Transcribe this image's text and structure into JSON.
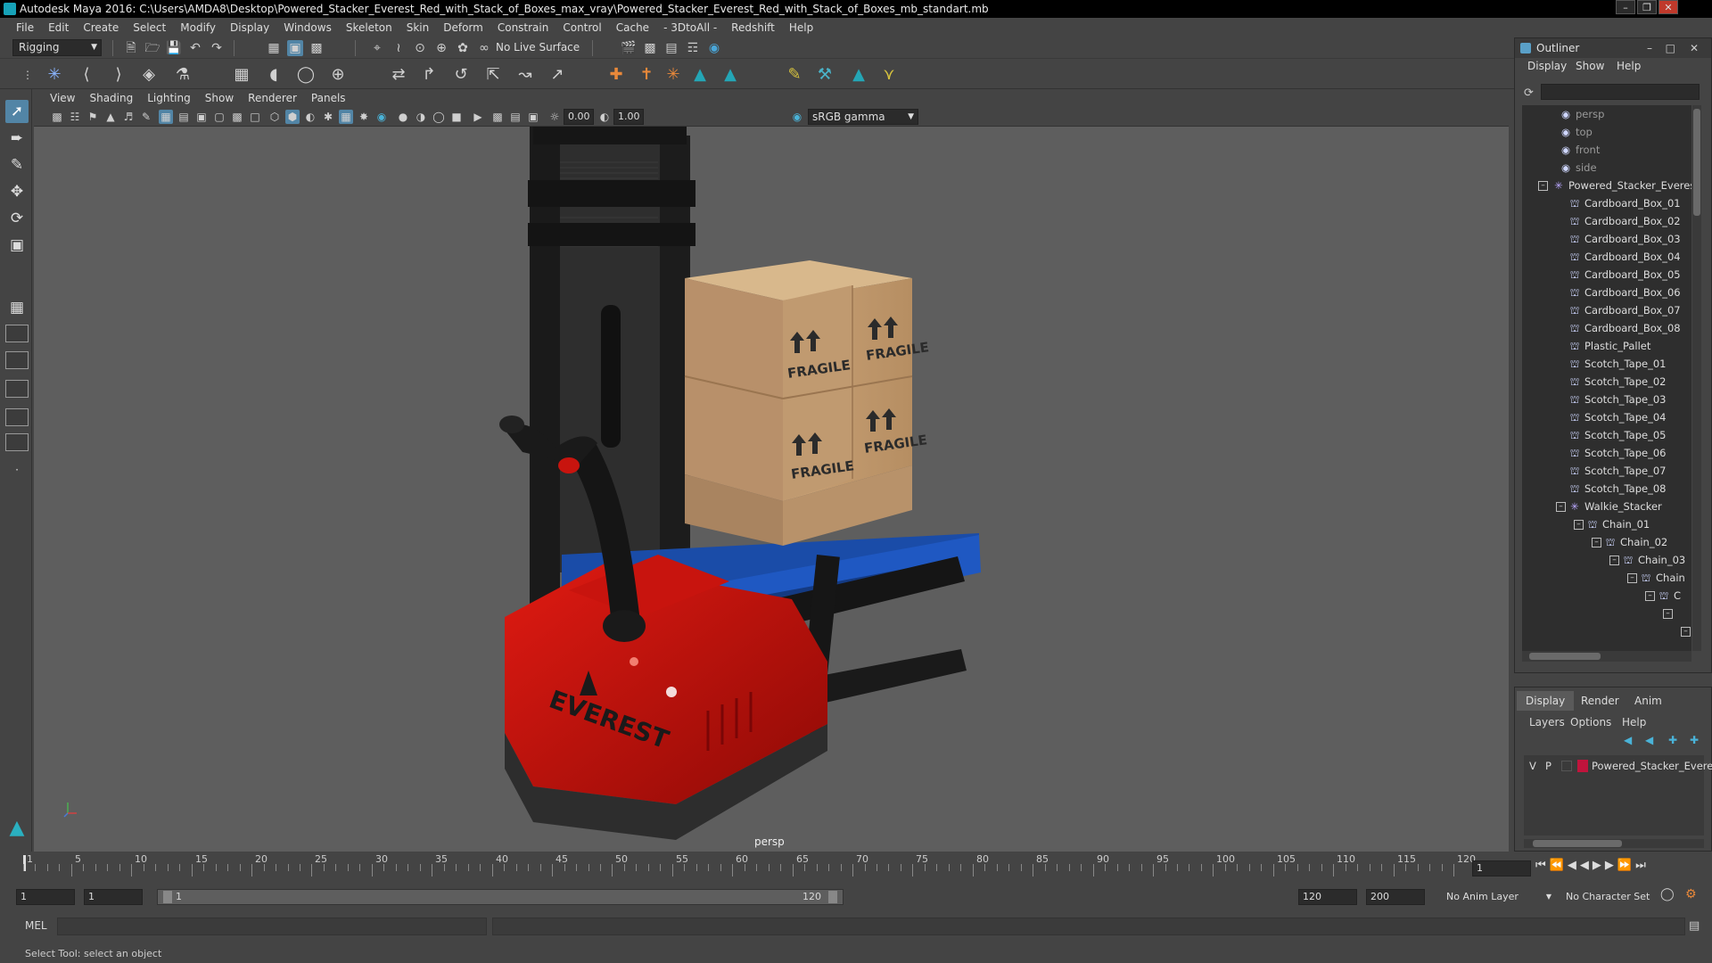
{
  "window": {
    "title": "Autodesk Maya 2016: C:\\Users\\AMDA8\\Desktop\\Powered_Stacker_Everest_Red_with_Stack_of_Boxes_max_vray\\Powered_Stacker_Everest_Red_with_Stack_of_Boxes_mb_standart.mb"
  },
  "menubar": [
    "File",
    "Edit",
    "Create",
    "Select",
    "Modify",
    "Display",
    "Windows",
    "Skeleton",
    "Skin",
    "Deform",
    "Constrain",
    "Control",
    "Cache",
    "- 3DtoAll -",
    "Redshift",
    "Help"
  ],
  "statusline": {
    "menuset": "Rigging",
    "live_surface": "No Live Surface"
  },
  "viewport": {
    "menus": [
      "View",
      "Shading",
      "Lighting",
      "Show",
      "Renderer",
      "Panels"
    ],
    "exposure": "0.00",
    "gamma": "1.00",
    "colorspace": "sRGB gamma",
    "camera_label": "persp",
    "scene_text": {
      "box_label": "FRAGILE",
      "brand": "EVEREST"
    }
  },
  "outliner": {
    "title": "Outliner",
    "menus": [
      "Display",
      "Show",
      "Help"
    ],
    "cameras": [
      "persp",
      "top",
      "front",
      "side"
    ],
    "root": "Powered_Stacker_Everest",
    "children": [
      "Cardboard_Box_01",
      "Cardboard_Box_02",
      "Cardboard_Box_03",
      "Cardboard_Box_04",
      "Cardboard_Box_05",
      "Cardboard_Box_06",
      "Cardboard_Box_07",
      "Cardboard_Box_08",
      "Plastic_Pallet",
      "Scotch_Tape_01",
      "Scotch_Tape_02",
      "Scotch_Tape_03",
      "Scotch_Tape_04",
      "Scotch_Tape_05",
      "Scotch_Tape_06",
      "Scotch_Tape_07",
      "Scotch_Tape_08"
    ],
    "walkie": "Walkie_Stacker",
    "chain": [
      "Chain_01",
      "Chain_02",
      "Chain_03",
      "Chain",
      "C"
    ]
  },
  "layers": {
    "tabs": [
      "Display",
      "Render",
      "Anim"
    ],
    "menus": [
      "Layers",
      "Options",
      "Help"
    ],
    "layer_v": "V",
    "layer_p": "P",
    "layer_name": "Powered_Stacker_Everest",
    "layer_color": "#c0143c"
  },
  "timeline": {
    "ticks": [
      "1",
      "5",
      "10",
      "15",
      "20",
      "25",
      "30",
      "35",
      "40",
      "45",
      "50",
      "55",
      "60",
      "65",
      "70",
      "75",
      "80",
      "85",
      "90",
      "95",
      "100",
      "105",
      "110",
      "115",
      "120"
    ],
    "current_frame": "1"
  },
  "range": {
    "start": "1",
    "start2": "1",
    "slider_start": "1",
    "slider_end": "120",
    "end": "120",
    "end2": "200",
    "anim_layer": "No Anim Layer",
    "character_set": "No Character Set"
  },
  "cmdline": {
    "label": "MEL"
  },
  "helpline": {
    "text": "Select Tool: select an object"
  }
}
